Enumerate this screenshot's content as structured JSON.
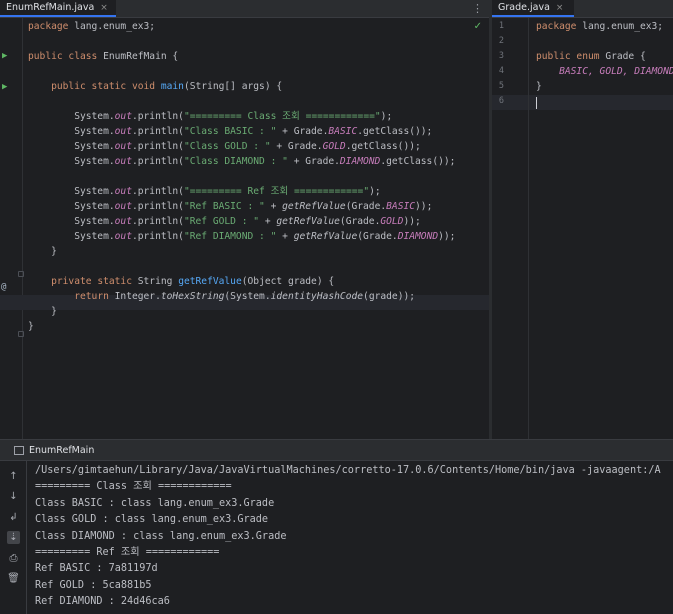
{
  "left_editor": {
    "tab_label": "EnumRefMain.java",
    "lines": [
      [
        {
          "t": "package",
          "c": "kw"
        },
        {
          "t": " lang.enum_ex3;",
          "c": ""
        }
      ],
      [],
      [
        {
          "t": "public class",
          "c": "kw"
        },
        {
          "t": " EnumRefMain {",
          "c": ""
        }
      ],
      [],
      [
        {
          "t": "    ",
          "c": ""
        },
        {
          "t": "public static void",
          "c": "kw"
        },
        {
          "t": " ",
          "c": ""
        },
        {
          "t": "main",
          "c": "fn"
        },
        {
          "t": "(String[] args) {",
          "c": ""
        }
      ],
      [],
      [
        {
          "t": "        System.",
          "c": ""
        },
        {
          "t": "out",
          "c": "fld"
        },
        {
          "t": ".println(",
          "c": ""
        },
        {
          "t": "\"========= Class 조회 ============\"",
          "c": "str"
        },
        {
          "t": ");",
          "c": ""
        }
      ],
      [
        {
          "t": "        System.",
          "c": ""
        },
        {
          "t": "out",
          "c": "fld"
        },
        {
          "t": ".println(",
          "c": ""
        },
        {
          "t": "\"Class BASIC : \"",
          "c": "str"
        },
        {
          "t": " + Grade.",
          "c": ""
        },
        {
          "t": "BASIC",
          "c": "enm"
        },
        {
          "t": ".getClass());",
          "c": ""
        }
      ],
      [
        {
          "t": "        System.",
          "c": ""
        },
        {
          "t": "out",
          "c": "fld"
        },
        {
          "t": ".println(",
          "c": ""
        },
        {
          "t": "\"Class GOLD : \"",
          "c": "str"
        },
        {
          "t": " + Grade.",
          "c": ""
        },
        {
          "t": "GOLD",
          "c": "enm"
        },
        {
          "t": ".getClass());",
          "c": ""
        }
      ],
      [
        {
          "t": "        System.",
          "c": ""
        },
        {
          "t": "out",
          "c": "fld"
        },
        {
          "t": ".println(",
          "c": ""
        },
        {
          "t": "\"Class DIAMOND : \"",
          "c": "str"
        },
        {
          "t": " + Grade.",
          "c": ""
        },
        {
          "t": "DIAMOND",
          "c": "enm"
        },
        {
          "t": ".getClass());",
          "c": ""
        }
      ],
      [],
      [
        {
          "t": "        System.",
          "c": ""
        },
        {
          "t": "out",
          "c": "fld"
        },
        {
          "t": ".println(",
          "c": ""
        },
        {
          "t": "\"========= Ref 조회 ============\"",
          "c": "str"
        },
        {
          "t": ");",
          "c": ""
        }
      ],
      [
        {
          "t": "        System.",
          "c": ""
        },
        {
          "t": "out",
          "c": "fld"
        },
        {
          "t": ".println(",
          "c": ""
        },
        {
          "t": "\"Ref BASIC : \"",
          "c": "str"
        },
        {
          "t": " + ",
          "c": ""
        },
        {
          "t": "getRefValue",
          "c": "sfn"
        },
        {
          "t": "(Grade.",
          "c": ""
        },
        {
          "t": "BASIC",
          "c": "enm"
        },
        {
          "t": "));",
          "c": ""
        }
      ],
      [
        {
          "t": "        System.",
          "c": ""
        },
        {
          "t": "out",
          "c": "fld"
        },
        {
          "t": ".println(",
          "c": ""
        },
        {
          "t": "\"Ref GOLD : \"",
          "c": "str"
        },
        {
          "t": " + ",
          "c": ""
        },
        {
          "t": "getRefValue",
          "c": "sfn"
        },
        {
          "t": "(Grade.",
          "c": ""
        },
        {
          "t": "GOLD",
          "c": "enm"
        },
        {
          "t": "));",
          "c": ""
        }
      ],
      [
        {
          "t": "        System.",
          "c": ""
        },
        {
          "t": "out",
          "c": "fld"
        },
        {
          "t": ".println(",
          "c": ""
        },
        {
          "t": "\"Ref DIAMOND : \"",
          "c": "str"
        },
        {
          "t": " + ",
          "c": ""
        },
        {
          "t": "getRefValue",
          "c": "sfn"
        },
        {
          "t": "(Grade.",
          "c": ""
        },
        {
          "t": "DIAMOND",
          "c": "enm"
        },
        {
          "t": "));",
          "c": ""
        }
      ],
      [
        {
          "t": "    }",
          "c": ""
        }
      ],
      [],
      [
        {
          "t": "    ",
          "c": ""
        },
        {
          "t": "private static",
          "c": "kw"
        },
        {
          "t": " String ",
          "c": ""
        },
        {
          "t": "getRefValue",
          "c": "fn"
        },
        {
          "t": "(Object grade) {",
          "c": ""
        }
      ],
      [
        {
          "t": "        ",
          "c": ""
        },
        {
          "t": "return",
          "c": "kw"
        },
        {
          "t": " Integer.",
          "c": ""
        },
        {
          "t": "toHexString",
          "c": "sfn"
        },
        {
          "t": "(System.",
          "c": ""
        },
        {
          "t": "identityHashCode",
          "c": "sfn"
        },
        {
          "t": "(grade));",
          "c": ""
        }
      ],
      [
        {
          "t": "    }",
          "c": ""
        }
      ],
      [
        {
          "t": "}",
          "c": ""
        }
      ]
    ]
  },
  "right_editor": {
    "tab_label": "Grade.java",
    "line_numbers": [
      "1",
      "2",
      "3",
      "4",
      "5",
      "6"
    ],
    "lines": [
      [
        {
          "t": "package",
          "c": "kw"
        },
        {
          "t": " lang.enum_ex3;",
          "c": ""
        }
      ],
      [],
      [
        {
          "t": "public enum",
          "c": "kw"
        },
        {
          "t": " Grade {",
          "c": ""
        }
      ],
      [
        {
          "t": "    ",
          "c": ""
        },
        {
          "t": "BASIC, GOLD, DIAMOND",
          "c": "enm"
        }
      ],
      [
        {
          "t": "}",
          "c": ""
        }
      ],
      []
    ]
  },
  "console": {
    "tab_label": "EnumRefMain",
    "output": [
      "/Users/gimtaehun/Library/Java/JavaVirtualMachines/corretto-17.0.6/Contents/Home/bin/java -javaagent:/A",
      "========= Class 조회 ============",
      "Class BASIC : class lang.enum_ex3.Grade",
      "Class GOLD : class lang.enum_ex3.Grade",
      "Class DIAMOND : class lang.enum_ex3.Grade",
      "========= Ref 조회 ============",
      "Ref BASIC : 7a81197d",
      "Ref GOLD : 5ca881b5",
      "Ref DIAMOND : 24d46ca6"
    ]
  },
  "icons": {
    "close": "×",
    "menu": "⋮",
    "check": "✓",
    "run": "▶",
    "override": "@",
    "up": "↑",
    "down": "↓",
    "wrap": "↲",
    "scroll_end": "⇣",
    "print": "⎙",
    "trash": "🗑"
  },
  "colors": {
    "keyword": "#cf8e6d",
    "function": "#56a8f5",
    "string": "#6aab73",
    "field": "#c77dbb",
    "text": "#bcbec4",
    "background": "#1e1f22"
  }
}
